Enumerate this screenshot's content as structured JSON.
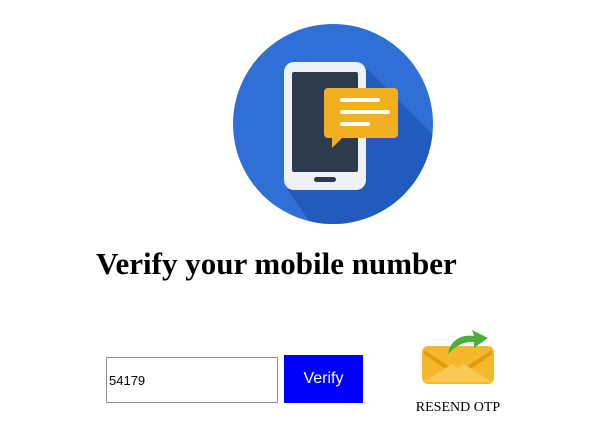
{
  "page": {
    "title": "Verify your mobile number"
  },
  "illustration": {
    "icon": "phone-message-icon",
    "colors": {
      "circle": "#2f6fd6",
      "shadow": "#1f58b8",
      "phone_frame": "#eef2f6",
      "phone_screen": "#2d3b4f",
      "bubble": "#f2b01e",
      "bubble_lines": "#ffffff"
    }
  },
  "form": {
    "otp_value": "54179",
    "verify_label": "Verify",
    "verify_color": "#0000ff"
  },
  "resend": {
    "label": "RESEND OTP",
    "icon": "envelope-resend-icon",
    "colors": {
      "envelope": "#f5b82a",
      "arrow": "#4caf3a"
    }
  }
}
